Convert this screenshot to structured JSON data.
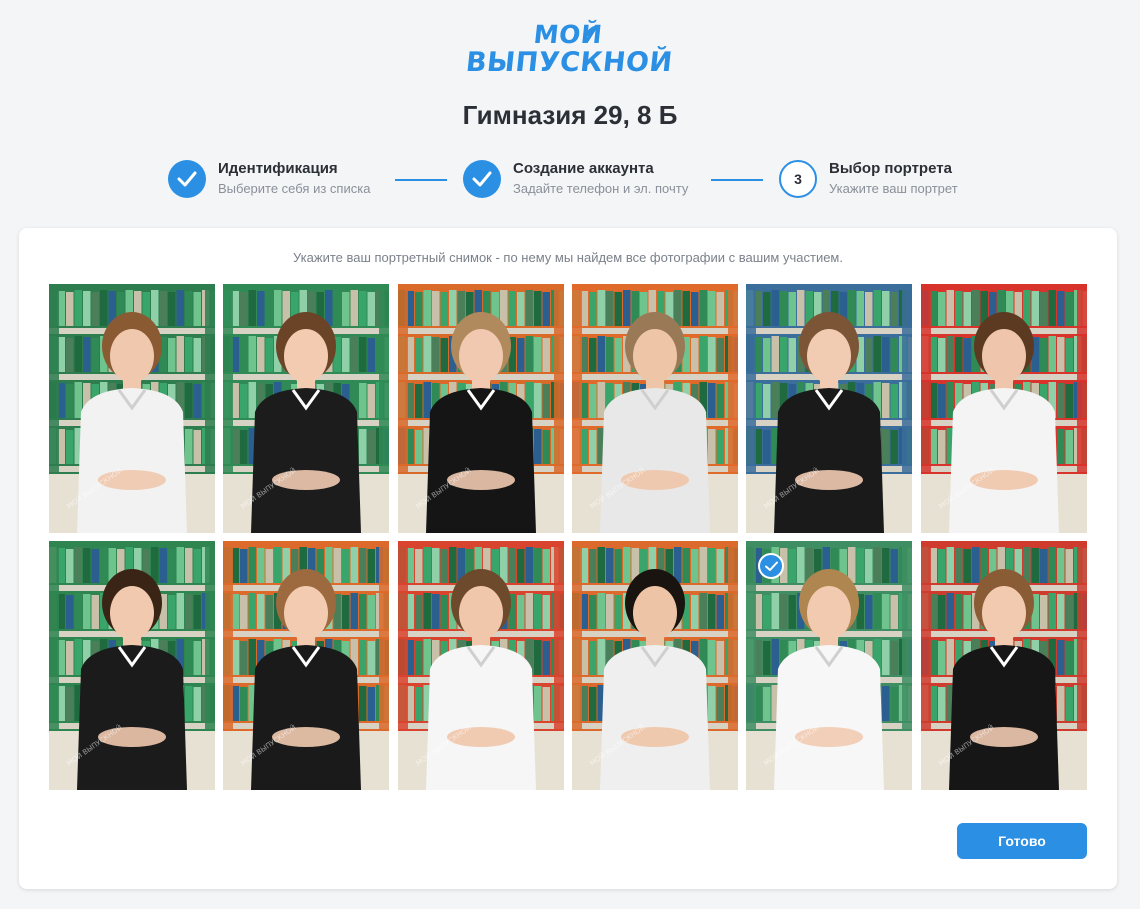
{
  "logo": {
    "line1": "МОЙ",
    "line2": "ВЫПУСКНОЙ"
  },
  "page_title": "Гимназия 29, 8 Б",
  "steps": [
    {
      "title": "Идентификация",
      "subtitle": "Выберите себя из списка",
      "status": "done"
    },
    {
      "title": "Создание аккаунта",
      "subtitle": "Задайте телефон и эл. почту",
      "status": "done"
    },
    {
      "title": "Выбор портрета",
      "subtitle": "Укажите ваш портрет",
      "status": "current",
      "number": "3"
    }
  ],
  "hint": "Укажите ваш портретный снимок - по нему мы найдем все фотографии с вашим участием.",
  "photos": [
    {
      "shirt": "#f2f2f2",
      "hair": "#8a5a32",
      "skin": "#f0c8ad",
      "bg": "#2e7d4f",
      "selected": false
    },
    {
      "shirt": "#1c1c1c",
      "hair": "#6b4428",
      "skin": "#f2cbb1",
      "bg": "#2f8a55",
      "selected": false
    },
    {
      "shirt": "#151515",
      "hair": "#b08a5c",
      "skin": "#f0c9b0",
      "bg": "#d96a2a",
      "selected": false
    },
    {
      "shirt": "#e8e8e8",
      "hair": "#9a7a56",
      "skin": "#efc5a8",
      "bg": "#e06a2a",
      "selected": false
    },
    {
      "shirt": "#1a1a1a",
      "hair": "#7c5436",
      "skin": "#f1cbb2",
      "bg": "#3b6e9a",
      "selected": false
    },
    {
      "shirt": "#f4f4f4",
      "hair": "#5c3a22",
      "skin": "#efc6ab",
      "bg": "#d8342c",
      "selected": false
    },
    {
      "shirt": "#1b1b1b",
      "hair": "#3a2416",
      "skin": "#f1c9ae",
      "bg": "#2e8550",
      "selected": false
    },
    {
      "shirt": "#1a1a1a",
      "hair": "#9c6a3e",
      "skin": "#f2cbb0",
      "bg": "#dd6a2a",
      "selected": false
    },
    {
      "shirt": "#f6f6f6",
      "hair": "#6e4a2c",
      "skin": "#f0c7ab",
      "bg": "#d9442e",
      "selected": false
    },
    {
      "shirt": "#efefef",
      "hair": "#1a1410",
      "skin": "#eec4a6",
      "bg": "#db6a2c",
      "selected": false
    },
    {
      "shirt": "#f7f7f7",
      "hair": "#b08650",
      "skin": "#f1cab0",
      "bg": "#3f8e63",
      "selected": true
    },
    {
      "shirt": "#161616",
      "hair": "#8a5c36",
      "skin": "#f1cab0",
      "bg": "#cf3c2e",
      "selected": false
    }
  ],
  "done_label": "Готово",
  "colors": {
    "accent": "#2b8fe3",
    "selected_outline": "#9ec6f7"
  },
  "icons": {
    "step_done": "check-icon",
    "photo_selected": "check-icon"
  }
}
